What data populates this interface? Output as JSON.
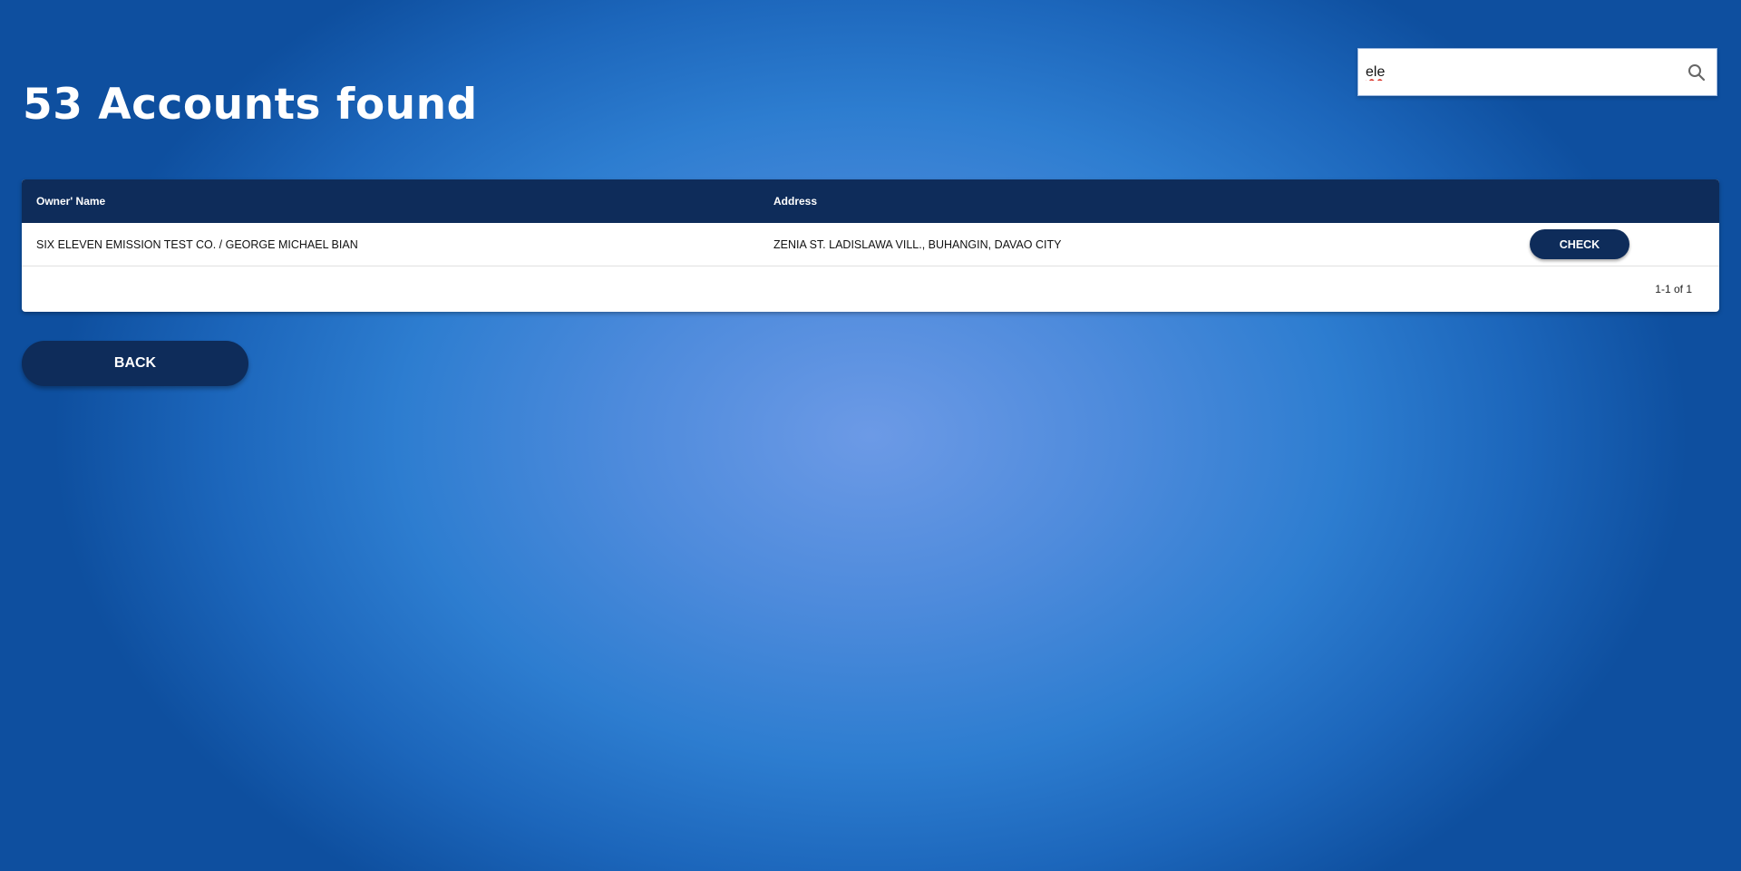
{
  "header": {
    "title": "53 Accounts found"
  },
  "search": {
    "value": "ele",
    "icon": "search-icon"
  },
  "table": {
    "columns": [
      "Owner' Name",
      "Address",
      ""
    ],
    "rows": [
      {
        "owner_name": "SIX ELEVEN EMISSION TEST CO. / GEORGE MICHAEL BIAN",
        "address": "ZENIA ST. LADISLAWA VILL., BUHANGIN, DAVAO CITY",
        "action_label": "CHECK"
      }
    ],
    "pagination": "1-1 of 1"
  },
  "actions": {
    "back_label": "BACK"
  },
  "colors": {
    "primary_navy": "#0e2c5a",
    "background_blue": "#2d7dd0",
    "surface": "#ffffff"
  }
}
